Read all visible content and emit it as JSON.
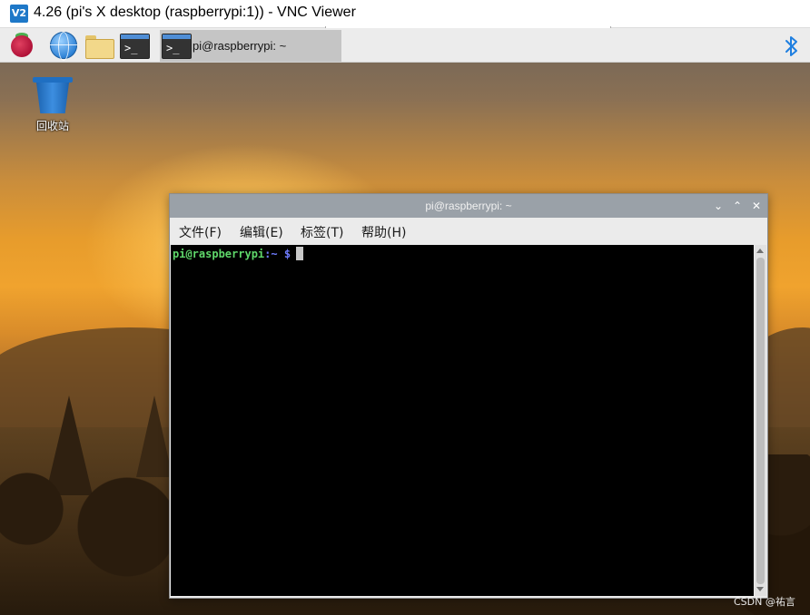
{
  "vnc_window": {
    "logo_text": "V2",
    "title": "4.26 (pi's X desktop (raspberrypi:1)) - VNC Viewer"
  },
  "taskbar": {
    "launchers": [
      {
        "name": "raspberry-menu-icon"
      },
      {
        "name": "web-browser-icon"
      },
      {
        "name": "file-manager-icon"
      },
      {
        "name": "terminal-icon"
      }
    ],
    "active_task": {
      "icon": "terminal-icon",
      "label": "pi@raspberrypi: ~"
    },
    "tray": {
      "bluetooth_icon": "bluetooth-icon"
    }
  },
  "desktop": {
    "icons": [
      {
        "label": "回收站",
        "icon": "trash-icon"
      }
    ]
  },
  "terminal": {
    "title": "pi@raspberrypi: ~",
    "controls": {
      "minimize": "⌄",
      "maximize": "⌃",
      "close": "✕"
    },
    "menu": {
      "file": "文件(F)",
      "edit": "编辑(E)",
      "tabs": "标签(T)",
      "help": "帮助(H)"
    },
    "prompt": {
      "user_host": "pi@raspberrypi",
      "colon": ":",
      "path": "~",
      "symbol": "$"
    },
    "colors": {
      "user": "#5fd76a",
      "path": "#6f7cff",
      "background": "#000000"
    }
  },
  "watermark": "CSDN @祐言"
}
